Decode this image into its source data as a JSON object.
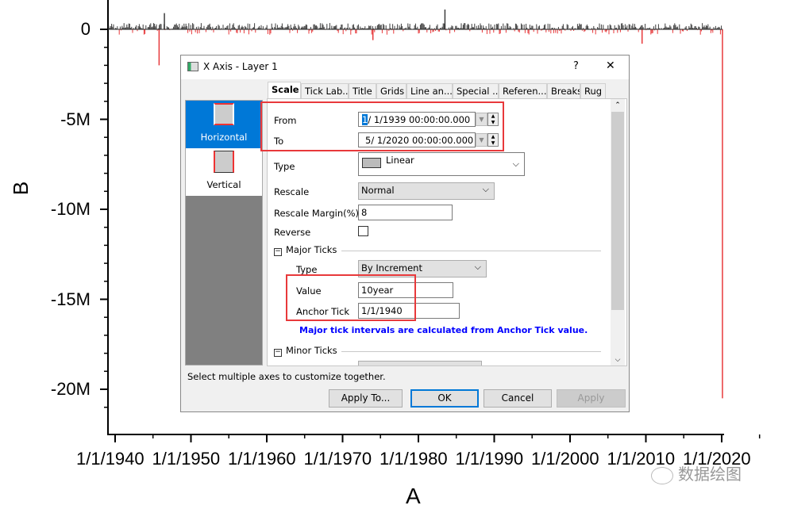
{
  "chart_data": {
    "type": "bar",
    "title": "",
    "xlabel": "A",
    "ylabel": "B",
    "xlim": [
      "1/1/1939",
      "5/1/2020"
    ],
    "ylim": [
      -21000000,
      800000
    ],
    "x_tick_labels": [
      "1/1/1940",
      "1/1/1950",
      "1/1/1960",
      "1/1/1970",
      "1/1/1980",
      "1/1/1990",
      "1/1/2000",
      "1/1/2010",
      "1/1/2020"
    ],
    "y_tick_labels": [
      "0",
      "-5M",
      "-10M",
      "-15M",
      "-20M"
    ],
    "y_tick_values": [
      0,
      -5000000,
      -10000000,
      -15000000,
      -20000000
    ],
    "notable_points": [
      {
        "year": 1945.8,
        "value": -2000000
      },
      {
        "year": 1946.5,
        "value": 900000
      },
      {
        "year": 1974.0,
        "value": -600000
      },
      {
        "year": 1983.5,
        "value": 1100000
      },
      {
        "year": 2009.5,
        "value": -800000
      },
      {
        "year": 2020.1,
        "value": -20500000
      }
    ],
    "positive_color": "#3c3c3c",
    "negative_color": "#e8393b"
  },
  "dialog": {
    "title": "X Axis - Layer 1",
    "help": "?",
    "close": "✕",
    "tabs": [
      "Scale",
      "Tick Lab...",
      "Title",
      "Grids",
      "Line an...",
      "Special ...",
      "Referen...",
      "Breaks",
      "Rug"
    ],
    "side_items": [
      "Horizontal",
      "Vertical"
    ],
    "from_label": "From",
    "from_sel": "1",
    "from_value": "/ 1/1939 00:00:00.000",
    "to_label": "To",
    "to_value": "5/ 1/2020 00:00:00.000",
    "type_label": "Type",
    "type_value": "Linear",
    "rescale_label": "Rescale",
    "rescale_value": "Normal",
    "margin_label": "Rescale Margin(%)",
    "margin_value": "8",
    "reverse_label": "Reverse",
    "major_ticks": "Major Ticks",
    "mt_type_label": "Type",
    "mt_type_value": "By Increment",
    "value_label": "Value",
    "value_value": "10year",
    "anchor_label": "Anchor Tick",
    "anchor_value": "1/1/1940",
    "note": "Major tick intervals are calculated from Anchor Tick value.",
    "minor_ticks": "Minor Ticks",
    "status": "Select multiple axes to customize together.",
    "buttons": [
      "Apply To...",
      "OK",
      "Cancel",
      "Apply"
    ]
  },
  "watermark": "数据绘图"
}
